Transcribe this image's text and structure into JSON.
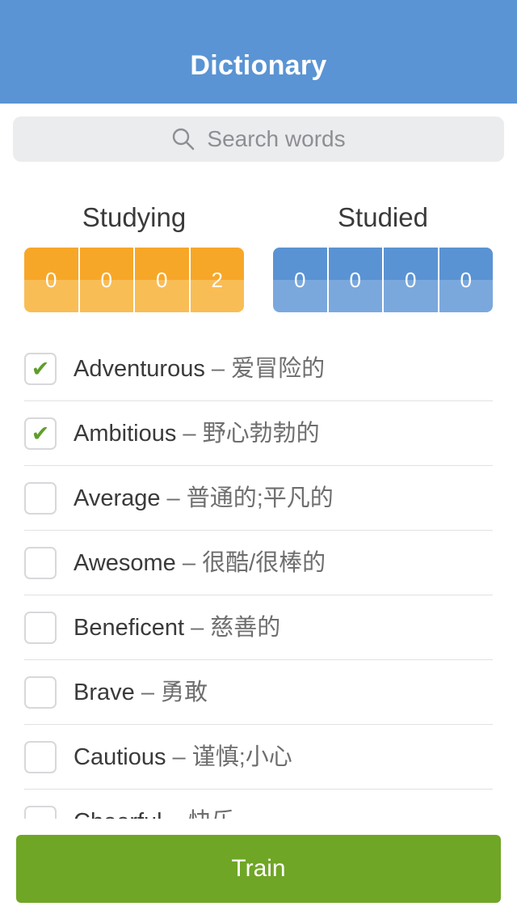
{
  "navbar": {
    "title": "Dictionary"
  },
  "search": {
    "placeholder": "Search words",
    "icon": "search-icon"
  },
  "counters": {
    "studying": {
      "label": "Studying",
      "digits": [
        "0",
        "0",
        "0",
        "2"
      ],
      "color": "#f7a728"
    },
    "studied": {
      "label": "Studied",
      "digits": [
        "0",
        "0",
        "0",
        "0"
      ],
      "color": "#5a93d3"
    }
  },
  "words": [
    {
      "word": "Adventurous",
      "separator": " – ",
      "translation": "爱冒险的",
      "checked": true
    },
    {
      "word": "Ambitious",
      "separator": " – ",
      "translation": "野心勃勃的",
      "checked": true
    },
    {
      "word": "Average",
      "separator": " – ",
      "translation": "普通的;平凡的",
      "checked": false
    },
    {
      "word": "Awesome",
      "separator": " – ",
      "translation": "很酷/很棒的",
      "checked": false
    },
    {
      "word": "Beneficent",
      "separator": " – ",
      "translation": "慈善的",
      "checked": false
    },
    {
      "word": "Brave",
      "separator": " – ",
      "translation": "勇敢",
      "checked": false
    },
    {
      "word": "Cautious",
      "separator": " – ",
      "translation": "谨慎;小心",
      "checked": false
    },
    {
      "word": "Cheerful",
      "separator": " – ",
      "translation": "快乐",
      "checked": false
    }
  ],
  "check_mark": "✔",
  "train": {
    "label": "Train"
  },
  "colors": {
    "header": "#5a94d4",
    "train": "#6fa625",
    "check": "#5f9e29"
  }
}
